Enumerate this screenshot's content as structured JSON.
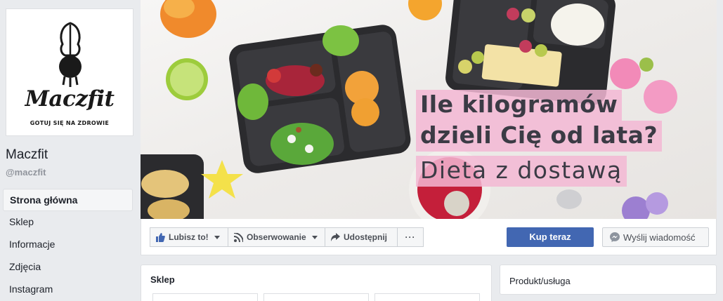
{
  "page": {
    "name": "Maczfit",
    "handle": "@maczfit",
    "logo_word": "Maczfit",
    "logo_tagline": "GOTUJ SIĘ NA ZDROWIE"
  },
  "nav": [
    {
      "label": "Strona główna",
      "active": true
    },
    {
      "label": "Sklep"
    },
    {
      "label": "Informacje"
    },
    {
      "label": "Zdjęcia"
    },
    {
      "label": "Instagram"
    }
  ],
  "cover": {
    "headline_line1": "Ile kilogramów",
    "headline_line2": "dzieli Cię od lata?",
    "subline": "Dieta z dostawą"
  },
  "actions": {
    "like": "Lubisz to!",
    "follow": "Obserwowanie",
    "share": "Udostępnij",
    "more": "···",
    "shop_now": "Kup teraz",
    "send_message": "Wyślij wiadomość"
  },
  "shop_panel": {
    "title": "Sklep"
  },
  "category_panel": {
    "label": "Produkt/usługa"
  },
  "colors": {
    "primary": "#4267b2",
    "highlight": "#f3b7d4",
    "background": "#e9ebee"
  }
}
